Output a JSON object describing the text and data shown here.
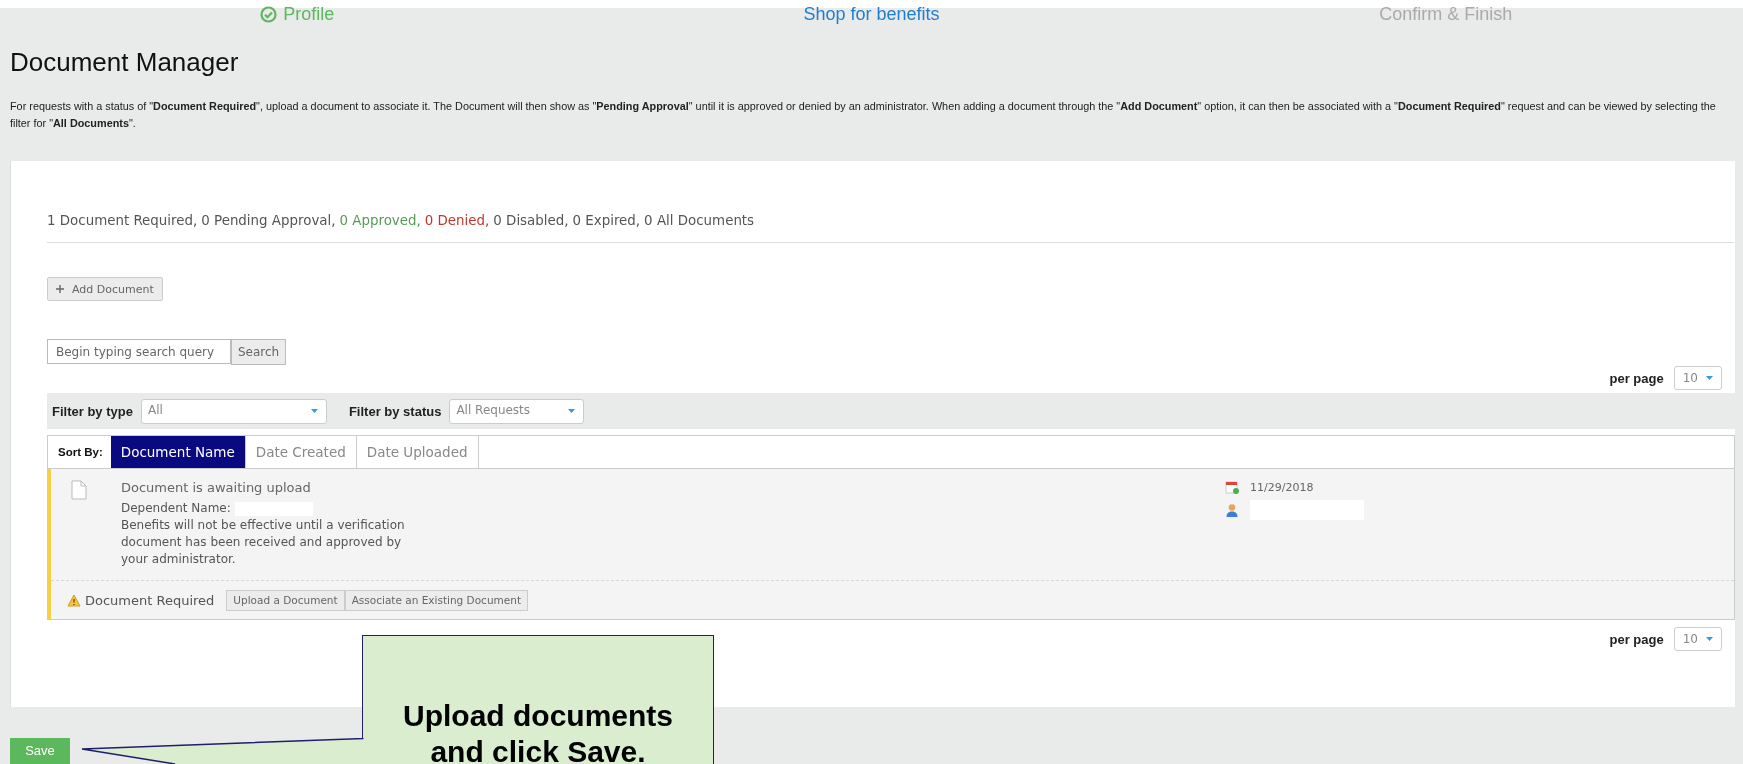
{
  "steps": [
    {
      "label": "Profile",
      "completed": true,
      "selected": false
    },
    {
      "label": "Shop for benefits",
      "completed": false,
      "selected": true
    },
    {
      "label": "Confirm & Finish",
      "completed": false,
      "selected": false
    }
  ],
  "title": "Document Manager",
  "description": "For requests with a status of \"**Document Required**\", upload a document to associate it. The Document will then show as \"**Pending Approval**\" until it is approved or denied by an administrator. When adding a document through the \"**Add Document**\" option, it can then be associated with a \"**Document Required**\" request and can be viewed by selecting the filter for \"**All Documents**\".",
  "counts": [
    {
      "text": "1 Document Required,",
      "color": "#555555"
    },
    {
      "text": "0 Pending Approval,",
      "color": "#555555"
    },
    {
      "text": "0 Approved,",
      "color": "#5a9a5a"
    },
    {
      "text": "0 Denied,",
      "color": "#c0392b"
    },
    {
      "text": "0 Disabled,",
      "color": "#555555"
    },
    {
      "text": "0 Expired,",
      "color": "#555555"
    },
    {
      "text": "0 All Documents",
      "color": "#555555"
    }
  ],
  "add_button": "Add Document",
  "search": {
    "placeholder": "Begin typing search query",
    "button": "Search"
  },
  "per_page_top": {
    "label": "per page",
    "value": "10"
  },
  "filters": [
    {
      "label": "Filter by type",
      "value": "All"
    },
    {
      "label": "Filter by status",
      "value": "All Requests"
    }
  ],
  "sort": {
    "label": "Sort By:",
    "options": [
      {
        "label": "Document Name",
        "selected": true
      },
      {
        "label": "Date Created",
        "selected": false
      },
      {
        "label": "Date Uploaded",
        "selected": false
      }
    ]
  },
  "documents": [
    {
      "title": "Document is awaiting upload",
      "dependent_label": "Dependent Name:",
      "note": "Benefits will not be effective until a verification document has been received and approved by your administrator.",
      "date": "11/29/2018",
      "status": "Document Required",
      "actions": [
        "Upload a Document",
        "Associate an Existing Document"
      ]
    }
  ],
  "per_page_bottom": {
    "label": "per page",
    "value": "10"
  },
  "save_button": "Save",
  "callout": "Upload documents and click Save."
}
